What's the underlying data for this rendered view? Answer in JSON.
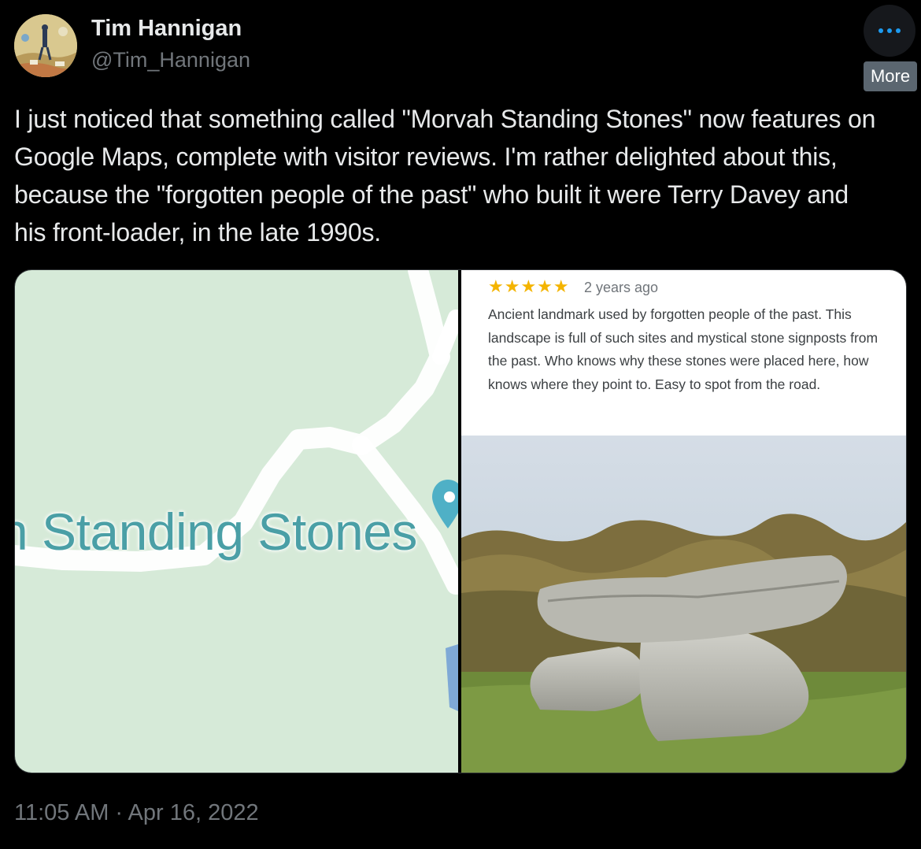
{
  "author": {
    "display_name": "Tim Hannigan",
    "handle": "@Tim_Hannigan"
  },
  "actions": {
    "more_tooltip": "More",
    "more_icon": "more-dots-icon"
  },
  "tweet": {
    "text": "I just noticed that something called \"Morvah Standing Stones\" now features on Google Maps, complete with visitor reviews. I'm rather delighted about this, because the \"forgotten people of the past\" who built it were Terry Davey and his front-loader, in the late 1990s.",
    "timestamp": "11:05 AM · Apr 16, 2022"
  },
  "media": {
    "map": {
      "place_label": "h Standing Stones",
      "pin_icon": "map-pin-icon"
    },
    "review": {
      "stars": "★★★★★",
      "rating": 5,
      "age": "2 years ago",
      "text": "Ancient landmark used by forgotten people of the past. This landscape is full of such sites and mystical stone signposts from the past. Who knows why these stones were placed here, how knows where they point to. Easy to spot from the road."
    }
  },
  "colors": {
    "background": "#000000",
    "text": "#e7e9ea",
    "muted": "#71767b",
    "accent": "#1d9bf0",
    "map_green": "#d6ead8",
    "star": "#f4b400"
  }
}
